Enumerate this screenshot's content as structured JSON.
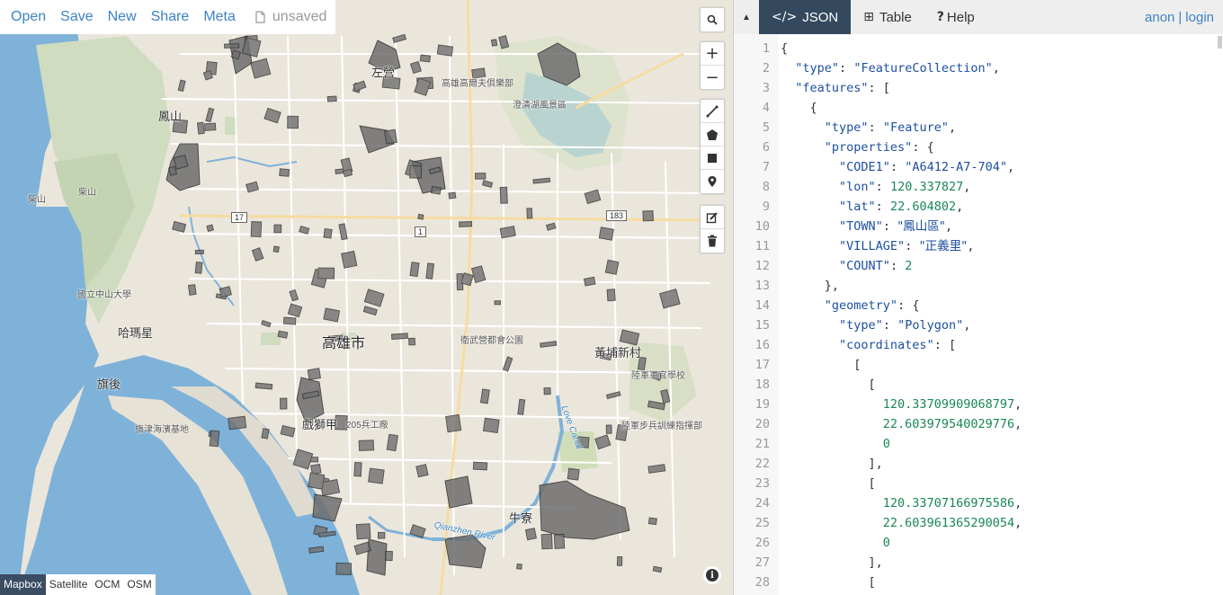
{
  "menu": {
    "items": [
      "Open",
      "Save",
      "New",
      "Share",
      "Meta"
    ],
    "file_status": "unsaved"
  },
  "map_controls": {
    "search": "search-icon",
    "zoom_in": "+",
    "zoom_out": "−",
    "draw_tools": [
      "draw-line-icon",
      "draw-polygon-icon",
      "draw-rectangle-icon",
      "draw-marker-icon"
    ],
    "edit_tools": [
      "edit-layers-icon",
      "delete-layers-icon"
    ]
  },
  "layers": [
    "Mapbox",
    "Satellite",
    "OCM",
    "OSM"
  ],
  "active_layer": "Mapbox",
  "map_labels": {
    "city": "高雄市",
    "hamasing": "哈瑪星",
    "cijin": "旗後",
    "lingya": "戲獅甲",
    "chaishan": "柴山",
    "chaishan2": "柴山",
    "golf": "高雄高爾夫俱樂部",
    "lotus": "澄清湖風景區",
    "univ": "國立中山大學",
    "huangpu": "黃埔新村",
    "academy": "陸軍軍官學校",
    "park": "衛武營都會公園",
    "fortress": "205兵工廠",
    "infantry": "陸軍步兵訓練指揮部",
    "niuliao": "牛寮",
    "port": "旗津海濱基地",
    "river": "Qianzhen River",
    "canal": "Love Canal",
    "route17": "17",
    "route1": "1",
    "route183": "183",
    "yanchao": "左營",
    "fengshan": "鳳山"
  },
  "tabs": [
    {
      "icon": "</>",
      "label": "JSON"
    },
    {
      "icon": "⊞",
      "label": "Table"
    },
    {
      "icon": "?",
      "label": "Help"
    }
  ],
  "active_tab": "JSON",
  "user": {
    "anon": "anon",
    "sep": "|",
    "login": "login"
  },
  "code_lines": [
    "{",
    "  \"type\": \"FeatureCollection\",",
    "  \"features\": [",
    "    {",
    "      \"type\": \"Feature\",",
    "      \"properties\": {",
    "        \"CODE1\": \"A6412-A7-704\",",
    "        \"lon\": 120.337827,",
    "        \"lat\": 22.604802,",
    "        \"TOWN\": \"鳳山區\",",
    "        \"VILLAGE\": \"正義里\",",
    "        \"COUNT\": 2",
    "      },",
    "      \"geometry\": {",
    "        \"type\": \"Polygon\",",
    "        \"coordinates\": [",
    "          [",
    "            [",
    "              120.33709909068797,",
    "              22.603979540029776,",
    "              0",
    "            ],",
    "            [",
    "              120.33707166975586,",
    "              22.603961365290054,",
    "              0",
    "            ],",
    "            ["
  ]
}
